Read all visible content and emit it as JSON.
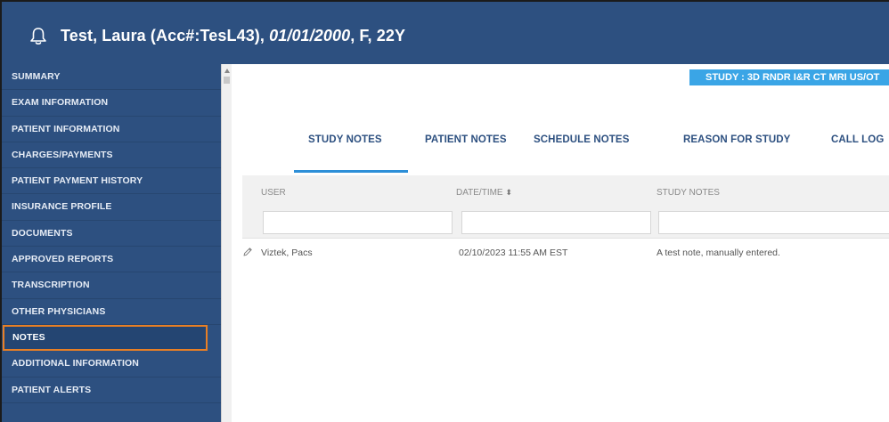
{
  "header": {
    "title_main": "Test, Laura (Acc#:TesL43),",
    "dob": "01/01/2000",
    "title_tail": ", F, 22Y"
  },
  "sidebar": {
    "items": [
      {
        "label": "SUMMARY"
      },
      {
        "label": "EXAM INFORMATION"
      },
      {
        "label": "PATIENT INFORMATION"
      },
      {
        "label": "CHARGES/PAYMENTS"
      },
      {
        "label": "PATIENT PAYMENT HISTORY"
      },
      {
        "label": "INSURANCE PROFILE"
      },
      {
        "label": "DOCUMENTS"
      },
      {
        "label": "APPROVED REPORTS"
      },
      {
        "label": "TRANSCRIPTION"
      },
      {
        "label": "OTHER PHYSICIANS"
      },
      {
        "label": "NOTES"
      },
      {
        "label": "ADDITIONAL INFORMATION"
      },
      {
        "label": "PATIENT ALERTS"
      }
    ],
    "active": "NOTES"
  },
  "study_badge": "STUDY : 3D RNDR I&R CT MRI US/OT",
  "tabs": [
    {
      "label": "STUDY NOTES"
    },
    {
      "label": "PATIENT NOTES"
    },
    {
      "label": "SCHEDULE NOTES"
    },
    {
      "label": "REASON FOR STUDY"
    },
    {
      "label": "CALL LOG"
    }
  ],
  "active_tab": "STUDY NOTES",
  "table": {
    "columns": [
      {
        "label": "USER"
      },
      {
        "label": "DATE/TIME"
      },
      {
        "label": "STUDY NOTES"
      }
    ],
    "rows": [
      {
        "user": "Viztek, Pacs",
        "datetime": "02/10/2023 11:55 AM EST",
        "note": "A test note, manually entered."
      }
    ]
  },
  "icons": {
    "header": "bell-icon",
    "row_action": "pencil-icon",
    "sort": "sort-icon"
  },
  "colors": {
    "sidebar_bg": "#2d5080",
    "active_outline": "#e87f25",
    "badge": "#3aa5e6",
    "tab_underline": "#2d8fd8"
  }
}
